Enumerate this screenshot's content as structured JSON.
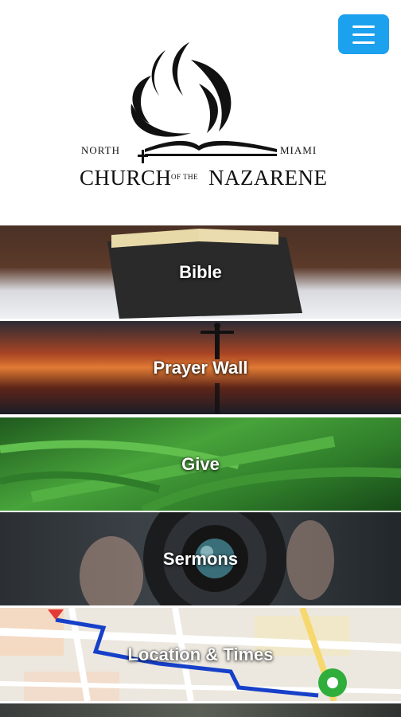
{
  "header": {
    "menu_icon": "hamburger-menu-icon",
    "menu_color": "#1ba1ee",
    "logo": {
      "north": "NORTH",
      "miami": "MIAMI",
      "church": "CHURCH",
      "of_the": "OF THE",
      "nazarene": "NAZARENE"
    }
  },
  "tiles": [
    {
      "label": "Bible"
    },
    {
      "label": "Prayer Wall"
    },
    {
      "label": "Give"
    },
    {
      "label": "Sermons"
    },
    {
      "label": "Location & Times"
    }
  ]
}
